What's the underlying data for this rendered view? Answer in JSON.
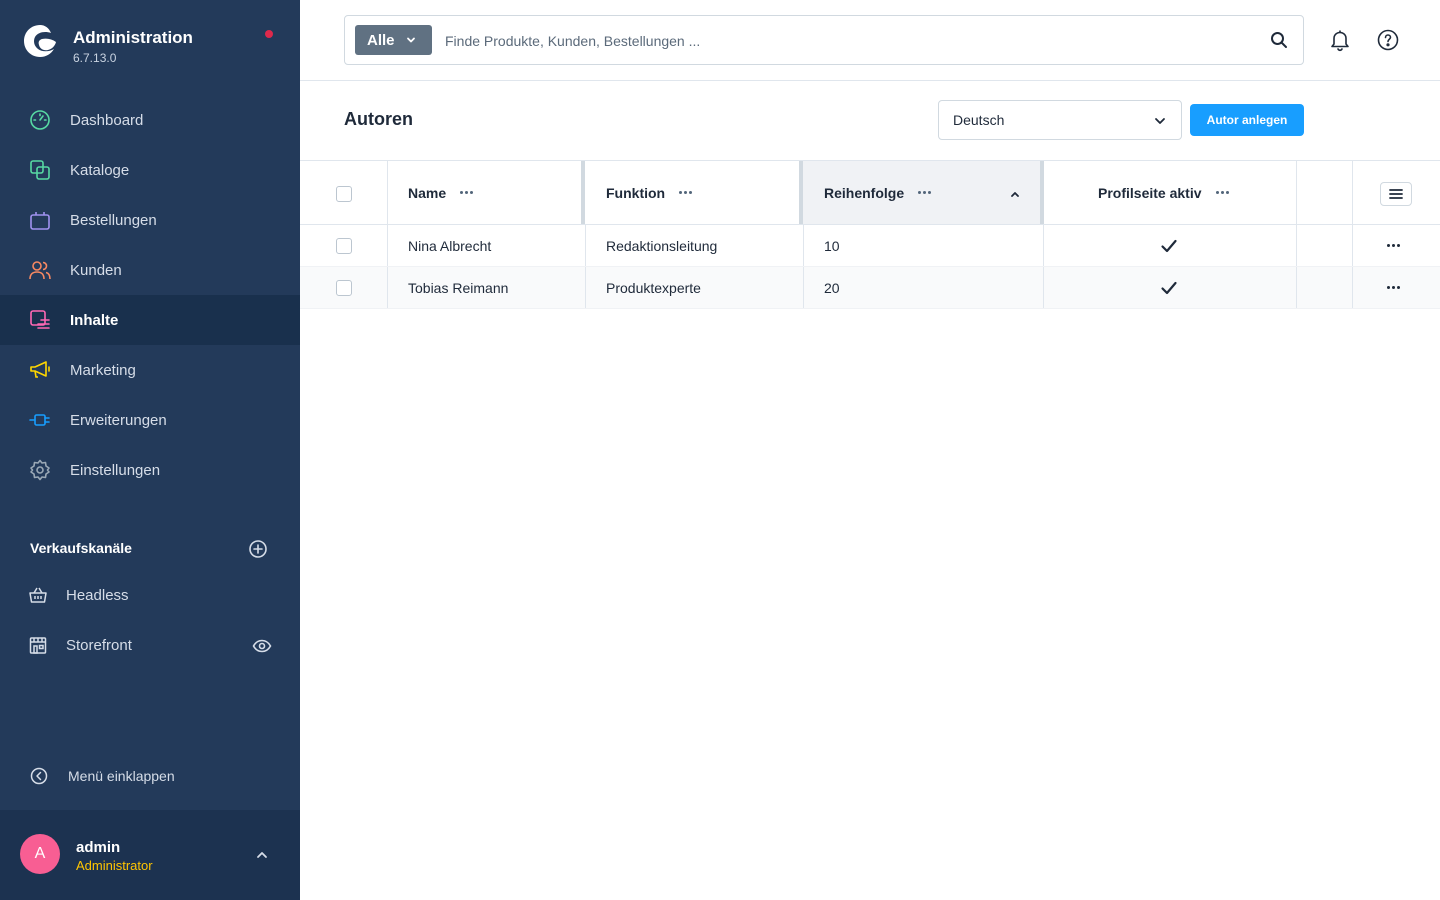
{
  "app": {
    "title": "Administration",
    "version": "6.7.13.0"
  },
  "nav": {
    "items": [
      {
        "label": "Dashboard",
        "icon": "dashboard-icon",
        "color": "#57d9a3"
      },
      {
        "label": "Kataloge",
        "icon": "catalog-icon",
        "color": "#57d9a3"
      },
      {
        "label": "Bestellungen",
        "icon": "shopping-bag-icon",
        "color": "#a092f0"
      },
      {
        "label": "Kunden",
        "icon": "users-icon",
        "color": "#f88962"
      },
      {
        "label": "Inhalte",
        "icon": "content-icon",
        "color": "#ff68b4",
        "active": true
      },
      {
        "label": "Marketing",
        "icon": "megaphone-icon",
        "color": "#ffd700"
      },
      {
        "label": "Erweiterungen",
        "icon": "plug-icon",
        "color": "#189eff"
      },
      {
        "label": "Einstellungen",
        "icon": "gear-icon",
        "color": "#9aa8b5"
      }
    ]
  },
  "sales_channels": {
    "title": "Verkaufskanäle",
    "items": [
      {
        "label": "Headless",
        "icon": "basket-icon"
      },
      {
        "label": "Storefront",
        "icon": "storefront-icon"
      }
    ]
  },
  "collapse_label": "Menü einklappen",
  "user": {
    "initial": "A",
    "name": "admin",
    "role": "Administrator"
  },
  "search": {
    "type_label": "Alle",
    "placeholder": "Finde Produkte, Kunden, Bestellungen ..."
  },
  "page": {
    "title": "Autoren",
    "language": "Deutsch",
    "create_button": "Autor anlegen"
  },
  "grid": {
    "columns": [
      "Name",
      "Funktion",
      "Reihenfolge",
      "Profilseite aktiv"
    ],
    "sorted_column": "Reihenfolge",
    "sort_direction": "ascending",
    "rows": [
      {
        "name": "Nina Albrecht",
        "function": "Redaktionsleitung",
        "order": "10",
        "profile_active": true
      },
      {
        "name": "Tobias Reimann",
        "function": "Produktexperte",
        "order": "20",
        "profile_active": true
      }
    ]
  },
  "colors": {
    "sidebar": "#233a5a",
    "sidebar_active": "#19304d",
    "primary": "#189eff",
    "notification_dot": "#de294c",
    "avatar": "#f85e93",
    "role_text": "#ffc501"
  }
}
